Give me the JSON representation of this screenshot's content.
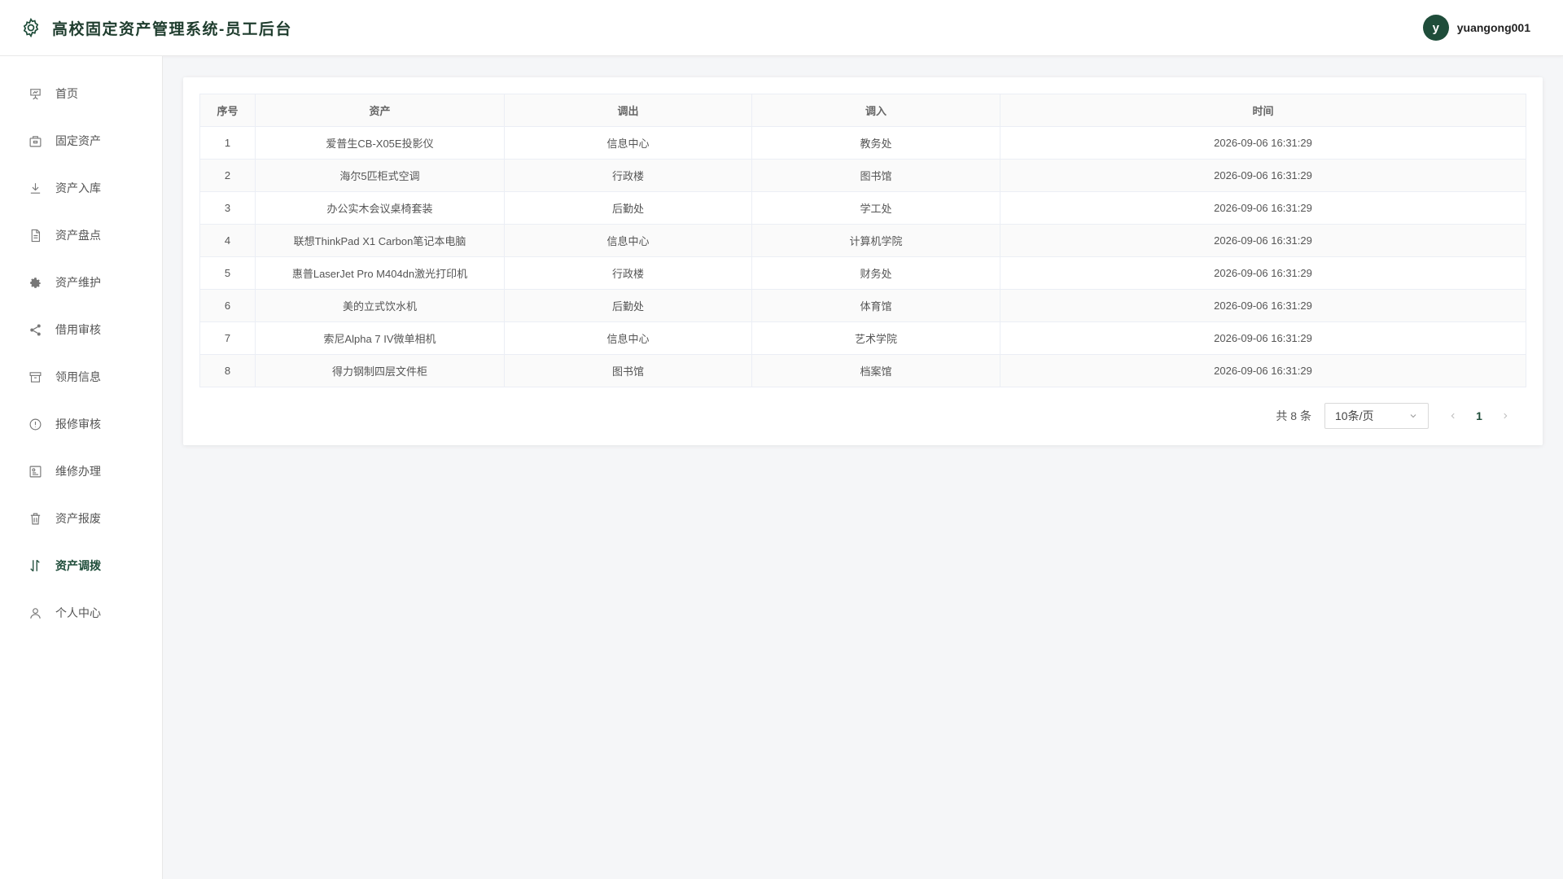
{
  "app": {
    "title": "高校固定资产管理系统-员工后台"
  },
  "user": {
    "avatar_letter": "y",
    "name": "yuangong001"
  },
  "colors": {
    "accent": "#1f4d3a"
  },
  "sidebar": {
    "items": [
      {
        "label": "首页",
        "icon": "presentation-chart-icon"
      },
      {
        "label": "固定资产",
        "icon": "package-icon"
      },
      {
        "label": "资产入库",
        "icon": "download-icon"
      },
      {
        "label": "资产盘点",
        "icon": "document-icon"
      },
      {
        "label": "资产维护",
        "icon": "cog-icon"
      },
      {
        "label": "借用审核",
        "icon": "share-icon"
      },
      {
        "label": "领用信息",
        "icon": "archive-box-icon"
      },
      {
        "label": "报修审核",
        "icon": "info-circle-icon"
      },
      {
        "label": "维修办理",
        "icon": "image-card-icon"
      },
      {
        "label": "资产报废",
        "icon": "trash-icon"
      },
      {
        "label": "资产调拨",
        "icon": "transfer-arrows-icon",
        "active": true
      },
      {
        "label": "个人中心",
        "icon": "user-icon"
      }
    ]
  },
  "table": {
    "headers": [
      "序号",
      "资产",
      "调出",
      "调入",
      "时间"
    ],
    "rows": [
      [
        "1",
        "爱普生CB-X05E投影仪",
        "信息中心",
        "教务处",
        "2026-09-06 16:31:29"
      ],
      [
        "2",
        "海尔5匹柜式空调",
        "行政楼",
        "图书馆",
        "2026-09-06 16:31:29"
      ],
      [
        "3",
        "办公实木会议桌椅套装",
        "后勤处",
        "学工处",
        "2026-09-06 16:31:29"
      ],
      [
        "4",
        "联想ThinkPad X1 Carbon笔记本电脑",
        "信息中心",
        "计算机学院",
        "2026-09-06 16:31:29"
      ],
      [
        "5",
        "惠普LaserJet Pro M404dn激光打印机",
        "行政楼",
        "财务处",
        "2026-09-06 16:31:29"
      ],
      [
        "6",
        "美的立式饮水机",
        "后勤处",
        "体育馆",
        "2026-09-06 16:31:29"
      ],
      [
        "7",
        "索尼Alpha 7 IV微单相机",
        "信息中心",
        "艺术学院",
        "2026-09-06 16:31:29"
      ],
      [
        "8",
        "得力钢制四层文件柜",
        "图书馆",
        "档案馆",
        "2026-09-06 16:31:29"
      ]
    ]
  },
  "pagination": {
    "total_text": "共 8 条",
    "page_size": "10条/页",
    "current_page": "1"
  }
}
